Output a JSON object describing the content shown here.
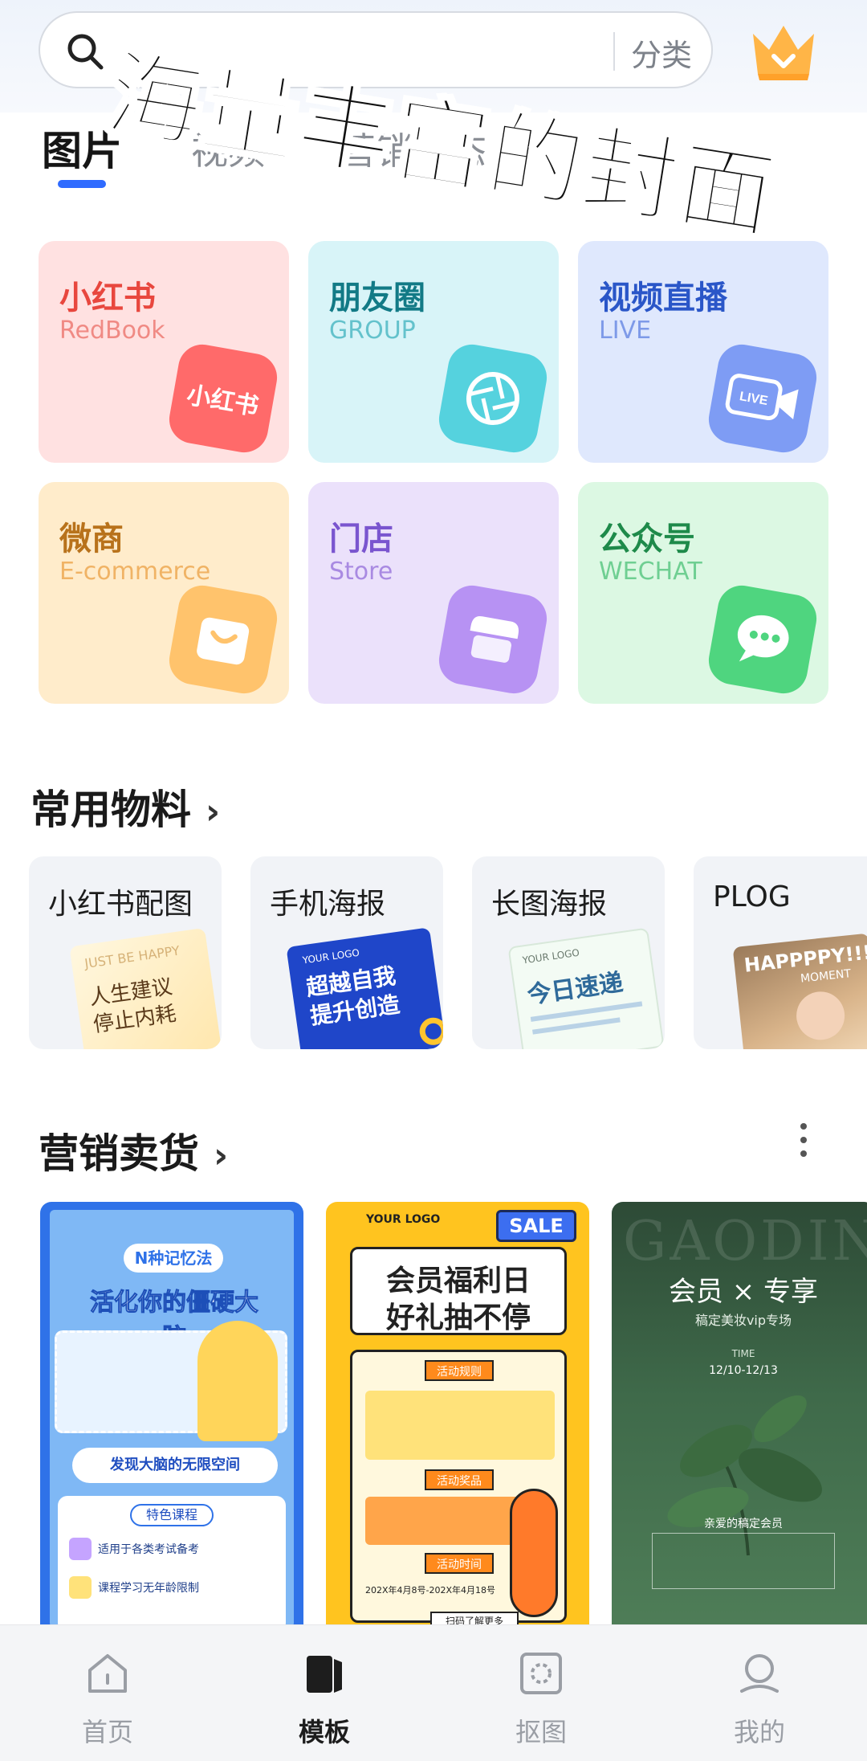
{
  "overlay_caption": "海量丰富的封面",
  "search": {
    "placeholder": "",
    "category_label": "分类"
  },
  "tabs": [
    {
      "label": "图片",
      "active": true
    },
    {
      "label": "视频",
      "active": false
    },
    {
      "label": "营销动态",
      "active": false
    }
  ],
  "categories": [
    {
      "title": "小红书",
      "subtitle": "RedBook",
      "icon": "xiaohongshu-icon",
      "icon_text": "小红书",
      "title_color": "#e8473e",
      "sub_color": "#f08a84",
      "bg": "#ffe1e1",
      "badge": "#ff6a6a"
    },
    {
      "title": "朋友圈",
      "subtitle": "GROUP",
      "icon": "camera-shutter-icon",
      "icon_text": "",
      "title_color": "#127a86",
      "sub_color": "#64c2cc",
      "bg": "#d8f4f8",
      "badge": "#55d2de"
    },
    {
      "title": "视频直播",
      "subtitle": "LIVE",
      "icon": "live-camera-icon",
      "icon_text": "LIVE",
      "title_color": "#2a56c8",
      "sub_color": "#7e9ae8",
      "bg": "#dfe8fd",
      "badge": "#7e9cf4"
    },
    {
      "title": "微商",
      "subtitle": "E-commerce",
      "icon": "shopping-bag-icon",
      "icon_text": "",
      "title_color": "#b8721b",
      "sub_color": "#f0b365",
      "bg": "#ffeccb",
      "badge": "#ffc36c"
    },
    {
      "title": "门店",
      "subtitle": "Store",
      "icon": "store-icon",
      "icon_text": "",
      "title_color": "#7a55cf",
      "sub_color": "#a98ae2",
      "bg": "#ebe1fb",
      "badge": "#b792f3"
    },
    {
      "title": "公众号",
      "subtitle": "WECHAT",
      "icon": "wechat-icon",
      "icon_text": "",
      "title_color": "#1e8a4a",
      "sub_color": "#6fcf92",
      "bg": "#dcf8e3",
      "badge": "#4fd57f"
    }
  ],
  "common_materials": {
    "title": "常用物料",
    "items": [
      {
        "label": "小红书配图",
        "thumb_text": "人生建议 停止内耗",
        "thumb_top": "JUST BE HAPPY"
      },
      {
        "label": "手机海报",
        "thumb_text": "超越自我 提升创造",
        "thumb_top": "YOUR LOGO"
      },
      {
        "label": "长图海报",
        "thumb_text": "今日速递",
        "thumb_top": "YOUR LOGO"
      },
      {
        "label": "PLOG",
        "thumb_text": "HAPPPPY!!!",
        "thumb_top": "MOMENT"
      }
    ]
  },
  "marketing": {
    "title": "营销卖货",
    "posters": [
      {
        "name": "memory-course-poster",
        "header": "N种记忆法",
        "headline": "活化你的僵硬大脑",
        "section": "发现大脑的无限空间",
        "sub": "特色课程",
        "line1": "适用于各类考试备考",
        "line2": "课程学习无年龄限制"
      },
      {
        "name": "member-benefit-poster",
        "logo": "YOUR LOGO",
        "sale": "SALE",
        "headline1": "会员福利日",
        "headline2": "好礼抽不停",
        "rule_title": "活动规则",
        "prize_title": "活动奖品",
        "time_title": "活动时间",
        "time": "202X年4月8号-202X年4月18号",
        "scan": "扫码了解更多"
      },
      {
        "name": "vip-member-poster",
        "brand": "GAODING",
        "headline": "会员 × 专享",
        "sub": "稿定美妆vip专场",
        "time_label": "TIME",
        "time": "12/10-12/13",
        "greet": "亲爱的稿定会员"
      }
    ]
  },
  "bottom_nav": [
    {
      "label": "首页",
      "icon": "home-icon",
      "active": false
    },
    {
      "label": "模板",
      "icon": "template-icon",
      "active": true
    },
    {
      "label": "抠图",
      "icon": "cutout-icon",
      "active": false
    },
    {
      "label": "我的",
      "icon": "profile-icon",
      "active": false
    }
  ]
}
